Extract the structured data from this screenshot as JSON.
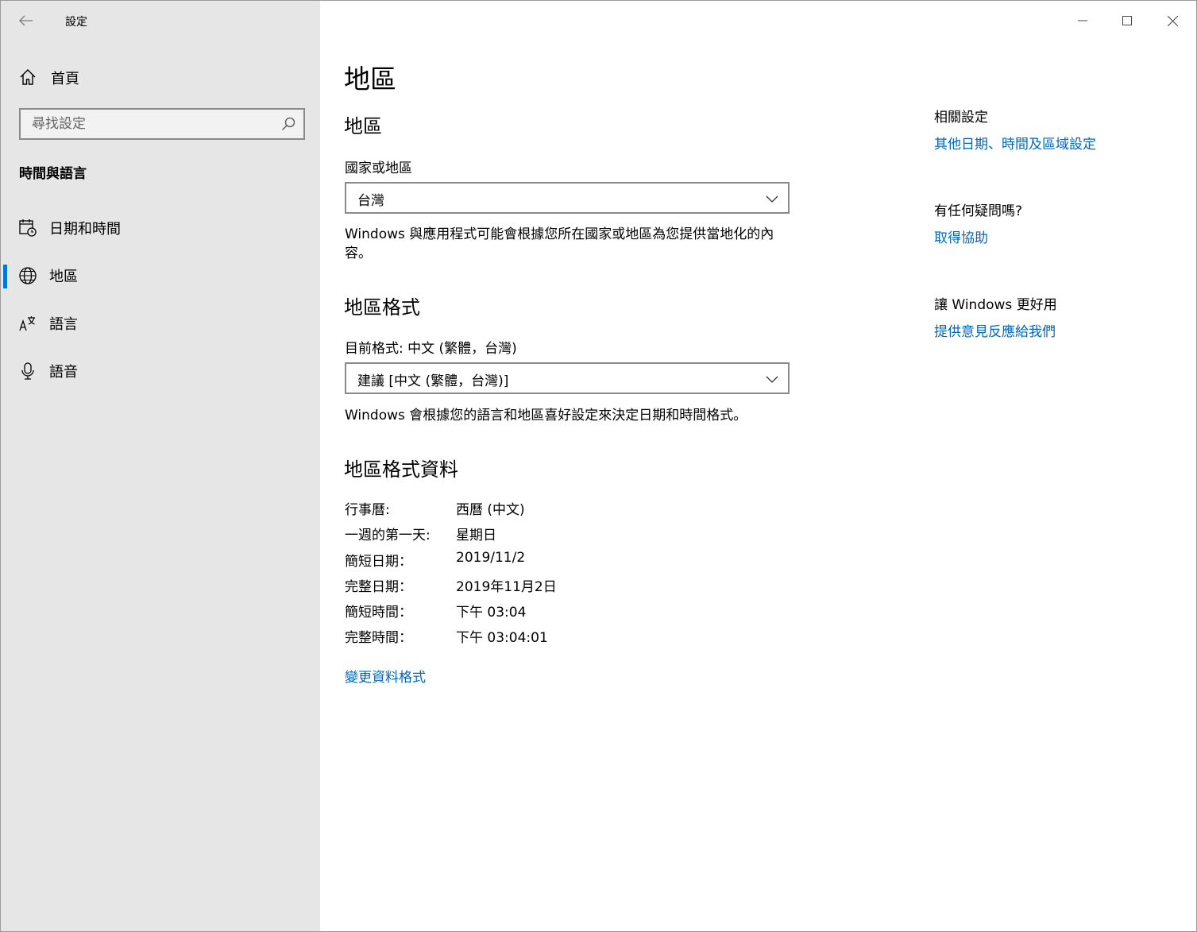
{
  "window": {
    "title": "設定"
  },
  "sidebar": {
    "home_label": "首頁",
    "search_placeholder": "尋找設定",
    "section_title": "時間與語言",
    "items": [
      {
        "label": "日期和時間",
        "icon": "calendar-clock-icon",
        "selected": false
      },
      {
        "label": "地區",
        "icon": "globe-icon",
        "selected": true
      },
      {
        "label": "語言",
        "icon": "language-icon",
        "selected": false
      },
      {
        "label": "語音",
        "icon": "microphone-icon",
        "selected": false
      }
    ]
  },
  "main": {
    "page_title": "地區",
    "region": {
      "heading": "地區",
      "country_label": "國家或地區",
      "country_value": "台灣",
      "description": "Windows 與應用程式可能會根據您所在國家或地區為您提供當地化的內容。"
    },
    "format": {
      "heading": "地區格式",
      "current_label": "目前格式: 中文 (繁體，台灣)",
      "selected_value": "建議 [中文 (繁體，台灣)]",
      "description": "Windows 會根據您的語言和地區喜好設定來決定日期和時間格式。"
    },
    "format_data": {
      "heading": "地區格式資料",
      "rows": [
        {
          "key": "行事曆:",
          "value": "西曆 (中文)"
        },
        {
          "key": "一週的第一天:",
          "value": "星期日"
        },
        {
          "key": "簡短日期：",
          "value": "2019/11/2"
        },
        {
          "key": "完整日期：",
          "value": "2019年11月2日"
        },
        {
          "key": "簡短時間：",
          "value": "下午 03:04"
        },
        {
          "key": "完整時間：",
          "value": "下午 03:04:01"
        }
      ],
      "change_link": "變更資料格式"
    }
  },
  "right": {
    "related_heading": "相關設定",
    "related_link": "其他日期、時間及區域設定",
    "help_heading": "有任何疑問嗎?",
    "help_link": "取得協助",
    "feedback_heading": "讓 Windows 更好用",
    "feedback_link": "提供意見反應給我們"
  },
  "colors": {
    "accent": "#0078d7",
    "link": "#0067c0",
    "sidebar_bg": "#e6e6e6"
  }
}
